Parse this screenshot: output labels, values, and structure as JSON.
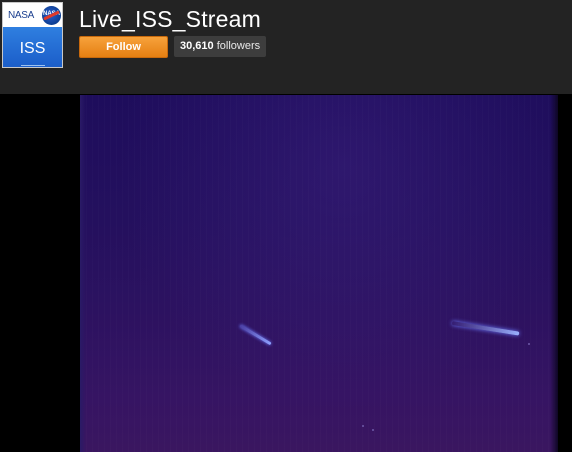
{
  "channel": {
    "avatar": {
      "logo_text": "NASA",
      "meatball_text": "NASA",
      "label": "ISS"
    },
    "title": "Live_ISS_Stream",
    "follow_label": "Follow",
    "followers": {
      "count": "30,610",
      "label": "followers"
    }
  },
  "colors": {
    "header_bg": "#232323",
    "follow_button": "#f08c22",
    "followers_badge": "#3d3d3d",
    "avatar_blue": "#1a5cc8",
    "video_bg": "#2a1260"
  },
  "icons": [
    "nasa-logo-icon"
  ]
}
